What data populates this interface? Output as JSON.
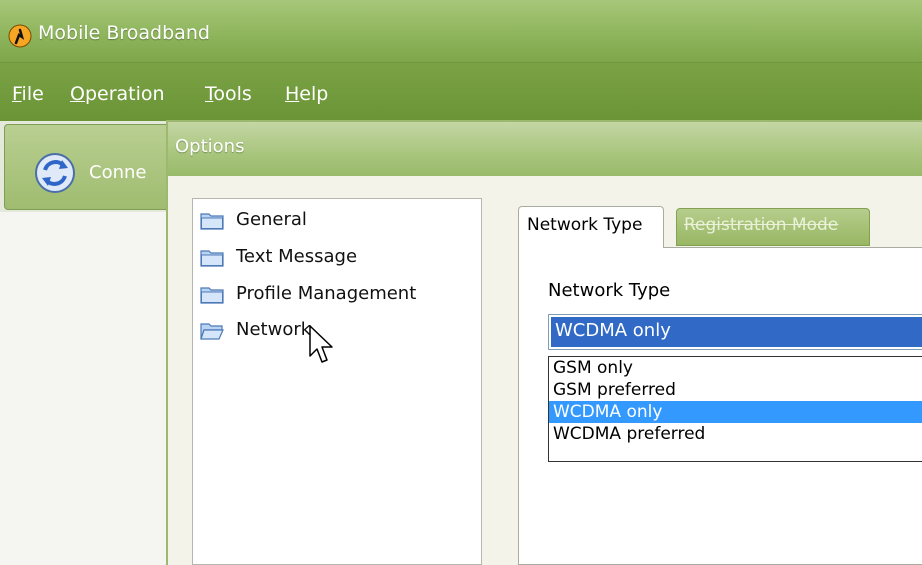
{
  "window": {
    "title": "Mobile Broadband",
    "menu": [
      "File",
      "Operation",
      "Tools",
      "Help"
    ],
    "menu_mnemonics": [
      "F",
      "O",
      "T",
      "H"
    ]
  },
  "toolbar": {
    "connect_label": "Conne"
  },
  "dialog": {
    "title": "Options",
    "tree": [
      {
        "label": "General",
        "icon": "folder-icon"
      },
      {
        "label": "Text Message",
        "icon": "folder-icon"
      },
      {
        "label": "Profile Management",
        "icon": "folder-icon"
      },
      {
        "label": "Network",
        "icon": "folder-open-icon"
      }
    ],
    "tabs": [
      {
        "label": "Network Type",
        "active": true
      },
      {
        "label": "Registration Mode",
        "active": false
      }
    ],
    "network_type": {
      "label": "Network Type",
      "selected": "WCDMA only",
      "options": [
        "GSM only",
        "GSM preferred",
        "WCDMA only",
        "WCDMA preferred"
      ]
    }
  },
  "colors": {
    "title_green": "#8fb55d",
    "menu_green": "#7ba345",
    "selection_blue": "#3169c6",
    "highlight_blue": "#3399ff"
  }
}
